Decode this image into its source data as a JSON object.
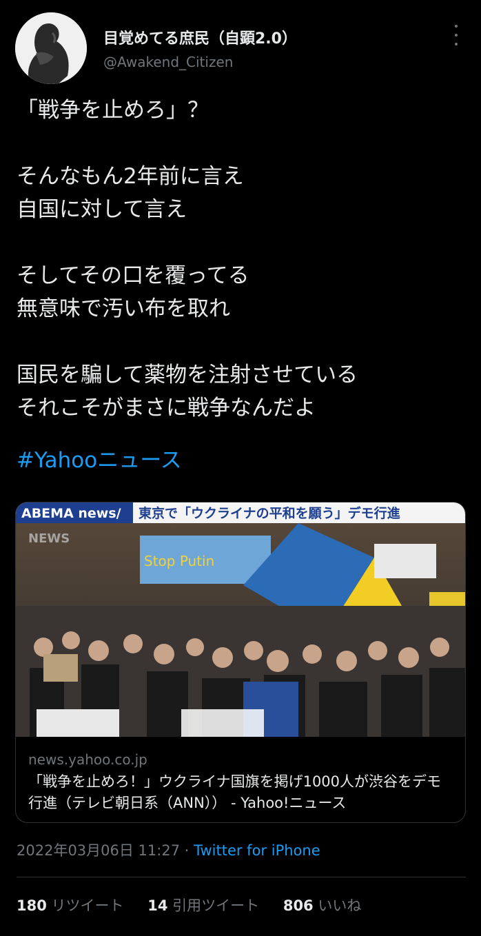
{
  "author": {
    "name": "目覚めてる庶民（自顕2.0）",
    "handle": "@Awakend_Citizen"
  },
  "tweet": {
    "text": "「戦争を止めろ」？\n\nそんなもん2年前に言え\n自国に対して言え\n\nそしてその口を覆ってる\n無意味で汚い布を取れ\n\n国民を騙して薬物を注射させている\nそれこそがまさに戦争なんだよ",
    "hashtag": "#Yahooニュース"
  },
  "card": {
    "image_banner_logo": "ABEMA news/",
    "image_banner_caption": "東京で「ウクライナの平和を願う」デモ行進",
    "image_watermark": "NEWS",
    "sign_text": "Stop Putin",
    "domain": "news.yahoo.co.jp",
    "title": "「戦争を止めろ！」ウクライナ国旗を掲げ1000人が渋谷をデモ行進（テレビ朝日系（ANN）） - Yahoo!ニュース"
  },
  "meta": {
    "timestamp": "2022年03月06日 11:27",
    "separator": " · ",
    "source": "Twitter for iPhone"
  },
  "stats": {
    "retweets_count": "180",
    "retweets_label": "リツイート",
    "quotes_count": "14",
    "quotes_label": "引用ツイート",
    "likes_count": "806",
    "likes_label": "いいね"
  },
  "colors": {
    "background": "#000000",
    "text": "#e7e9ea",
    "muted": "#71767b",
    "link": "#1d9bf0",
    "border": "#2f3336"
  }
}
